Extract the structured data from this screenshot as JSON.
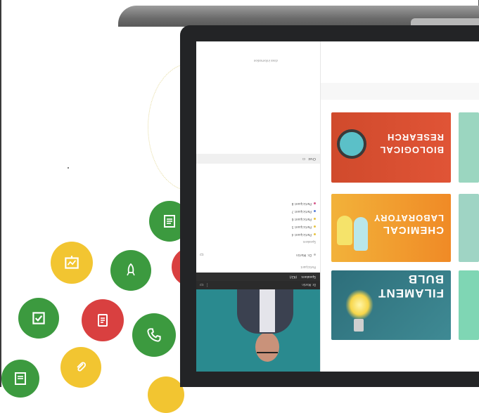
{
  "sidebar": {
    "header_title": "Dr. Martin",
    "subtitle": "(92/)",
    "section_title": "Speakers",
    "sub_label": "Participant",
    "items": [
      {
        "label": "Dr. Martin",
        "color": "#bfbfbf"
      },
      {
        "label": "Participant 4",
        "color": "#e8c442"
      },
      {
        "label": "Participant 5",
        "color": "#e8c442"
      },
      {
        "label": "Participant 6",
        "color": "#e8c442"
      },
      {
        "label": "Participant 7",
        "color": "#5a7fd8"
      },
      {
        "label": "Participant 8",
        "color": "#d65a8b"
      }
    ],
    "list_label": "Speakers",
    "chat_label": "Chat",
    "caption": "class information"
  },
  "cards": [
    {
      "title_line1": "BIOLOGICAL",
      "title_line2": "RESEARCH"
    },
    {
      "title_line1": "CHEMICAL",
      "title_line2": "LABORATORY"
    },
    {
      "title_line1": "FILAMENT",
      "title_line2": "BULB"
    }
  ],
  "icons": [
    "document-icon",
    "document-icon",
    "clipboard-icon",
    "rocket-icon",
    "notepad-icon",
    "phone-icon",
    "paperclip-icon",
    "chat-icon",
    "chart-icon"
  ],
  "colors": {
    "green": "#3c9a3f",
    "yellow": "#f2c531",
    "red": "#d94040",
    "teal_video": "#2a8a8f",
    "bezel": "#232426"
  }
}
